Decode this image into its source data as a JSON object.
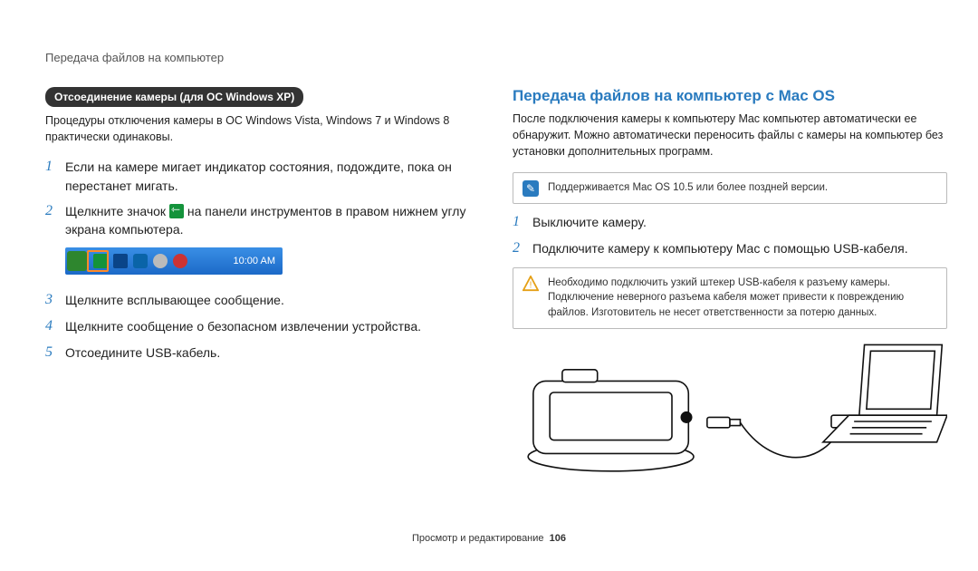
{
  "header": "Передача файлов на компьютер",
  "left": {
    "badge": "Отсоединение камеры (для ОС Windows XP)",
    "intro": "Процедуры отключения камеры в ОС Windows Vista, Windows 7 и Windows 8 практически одинаковы.",
    "steps": [
      "Если на камере мигает индикатор состояния, подождите, пока он перестанет мигать.",
      "Щелкните значок  на панели инструментов в правом нижнем углу экрана компьютера.",
      "Щелкните всплывающее сообщение.",
      "Щелкните сообщение о безопасном извлечении устройства.",
      "Отсоедините USB-кабель."
    ],
    "tray_time": "10:00 AM"
  },
  "right": {
    "heading": "Передача файлов на компьютер с Mac OS",
    "intro": "После подключения камеры к компьютеру Mac компьютер автоматически ее обнаружит. Можно автоматически переносить файлы с камеры на компьютер без установки дополнительных программ.",
    "note": "Поддерживается Mac OS 10.5 или более поздней версии.",
    "steps": [
      "Выключите камеру.",
      "Подключите камеру к компьютеру Mac с помощью USB-кабеля."
    ],
    "warn": "Необходимо подключить узкий штекер USB-кабеля к разъему камеры. Подключение неверного разъема кабеля может привести к повреждению файлов. Изготовитель не несет ответственности за потерю данных."
  },
  "footer": {
    "label": "Просмотр и редактирование",
    "page": "106"
  }
}
